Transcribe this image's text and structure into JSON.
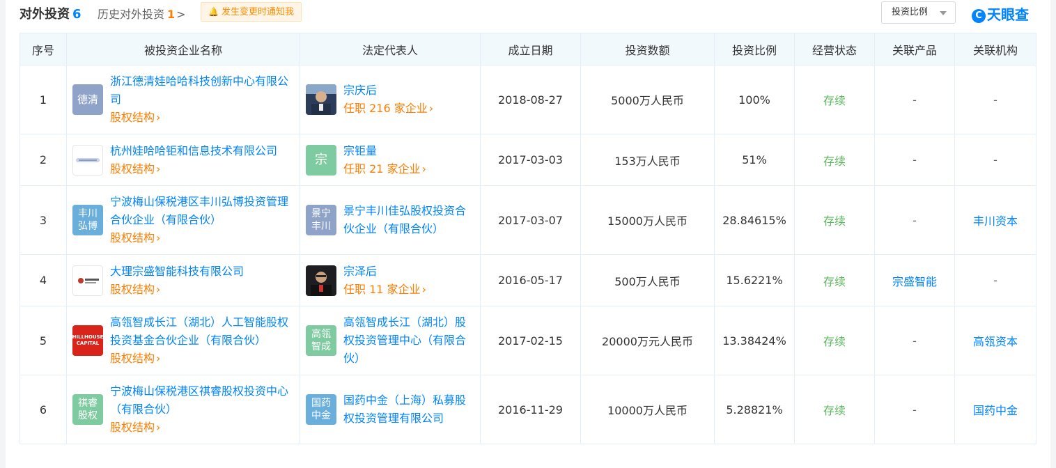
{
  "header": {
    "title": "对外投资",
    "count": "6",
    "history_label": "历史对外投资",
    "history_count": "1",
    "history_chevron": ">",
    "notify_label": "发生变更时通知我",
    "sort_label": "投资比例",
    "brand": "天眼查",
    "brand_mark": "C"
  },
  "columns": [
    "序号",
    "被投资企业名称",
    "法定代表人",
    "成立日期",
    "投资数额",
    "投资比例",
    "经营状态",
    "关联产品",
    "关联机构"
  ],
  "link_label": "股权结构",
  "rows": [
    {
      "idx": "1",
      "company": "浙江德清娃哈哈科技创新中心有限公司",
      "company_logo": "德清",
      "rep_name": "宗庆后",
      "rep_sub": "任职 216 家企业",
      "date": "2018-08-27",
      "amount": "5000万人民币",
      "ratio": "100%",
      "status": "存续",
      "product": "-",
      "org": "-"
    },
    {
      "idx": "2",
      "company": "杭州娃哈哈钜和信息技术有限公司",
      "company_logo": "",
      "rep_name": "宗钜量",
      "rep_avatar": "宗",
      "rep_sub": "任职 21 家企业",
      "date": "2017-03-03",
      "amount": "153万人民币",
      "ratio": "51%",
      "status": "存续",
      "product": "-",
      "org": "-"
    },
    {
      "idx": "3",
      "company": "宁波梅山保税港区丰川弘博投资管理合伙企业（有限合伙）",
      "company_logo": "丰川弘博",
      "rep_name": "景宁丰川佳弘股权投资合伙企业（有限合伙）",
      "rep_avatar": "景宁丰川",
      "date": "2017-03-07",
      "amount": "15000万人民币",
      "ratio": "28.84615%",
      "status": "存续",
      "product": "-",
      "org": "丰川资本"
    },
    {
      "idx": "4",
      "company": "大理宗盛智能科技有限公司",
      "company_logo": "",
      "rep_name": "宗泽后",
      "rep_sub": "任职 11 家企业",
      "date": "2016-05-17",
      "amount": "500万人民币",
      "ratio": "15.6221%",
      "status": "存续",
      "product": "宗盛智能",
      "org": "-"
    },
    {
      "idx": "5",
      "company": "高瓴智成长江（湖北）人工智能股权投资基金合伙企业（有限合伙）",
      "company_logo": "HILLHOUSE CAPITAL",
      "rep_name": "高瓴智成长江（湖北）股权投资管理中心（有限合伙）",
      "rep_avatar": "高瓴智成",
      "date": "2017-02-15",
      "amount": "20000万元人民币",
      "ratio": "13.38424%",
      "status": "存续",
      "product": "-",
      "org": "高瓴资本"
    },
    {
      "idx": "6",
      "company": "宁波梅山保税港区祺睿股权投资中心（有限合伙）",
      "company_logo": "祺睿股权",
      "rep_name": "国药中金（上海）私募股权投资管理有限公司",
      "rep_avatar": "国药中金",
      "date": "2016-11-29",
      "amount": "10000万人民币",
      "ratio": "5.28821%",
      "status": "存续",
      "product": "-",
      "org": "国药中金"
    }
  ],
  "colors": {
    "link_blue": "#0084ff",
    "orange": "#ff7d00",
    "status_green": "#5cb85c",
    "header_bg": "#f2f9fc"
  }
}
